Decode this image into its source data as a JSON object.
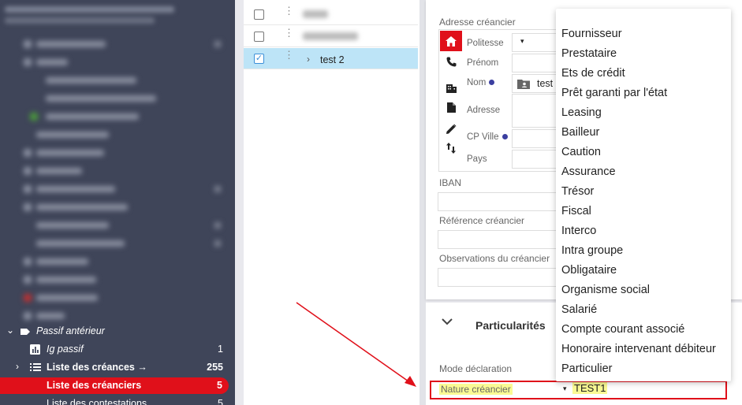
{
  "sidebar": {
    "passif_anterieur": "Passif antérieur",
    "items": [
      {
        "label": "Ig passif",
        "count": "1"
      },
      {
        "label": "Liste des créances →",
        "count": "255"
      },
      {
        "label": "Liste des créanciers",
        "count": "5"
      },
      {
        "label": "Liste des contestations",
        "count": "5"
      }
    ]
  },
  "list": {
    "selected_row_label": "test 2"
  },
  "form": {
    "adresse_label": "Adresse créancier",
    "address_fields": [
      "Politesse",
      "Prénom",
      "Nom",
      "Adresse",
      "CP Ville",
      "Pays"
    ],
    "nom_value": "test",
    "iban_label": "IBAN",
    "ref_label": "Référence créancier",
    "obs_label": "Observations du créancier"
  },
  "particularites": {
    "title": "Particularités",
    "mode_label": "Mode déclaration",
    "nature_label": "Nature créancier",
    "nature_value": "TEST1"
  },
  "dropdown": {
    "options": [
      "Fournisseur",
      "Prestataire",
      "Ets de crédit",
      "Prêt garanti par l'état",
      "Leasing",
      "Bailleur",
      "Caution",
      "Assurance",
      "Trésor",
      "Fiscal",
      "Interco",
      "Intra groupe",
      "Obligataire",
      "Organisme social",
      "Salarié",
      "Compte courant associé",
      "Honoraire intervenant débiteur",
      "Particulier"
    ]
  },
  "colors": {
    "sidebar_bg": "#3f4559",
    "accent_red": "#e0101a",
    "selection_blue": "#bde4f7",
    "highlight_yellow": "#fafa94"
  }
}
